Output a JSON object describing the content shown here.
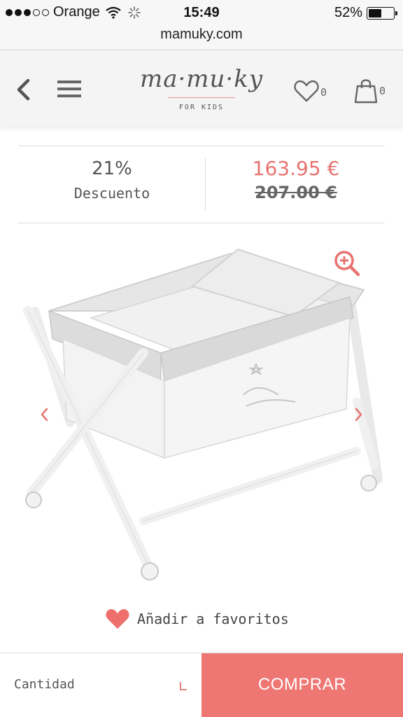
{
  "status_bar": {
    "carrier": "Orange",
    "time": "15:49",
    "battery": "52%",
    "battery_level": 0.52
  },
  "browser": {
    "url": "mamuky.com"
  },
  "header": {
    "logo": "ma·mu·ky",
    "logo_tagline": "FOR KIDS",
    "favorites_count": "0",
    "cart_count": "0"
  },
  "pricing": {
    "discount_percent": "21%",
    "discount_label": "Descuento",
    "current_price": "163.95 €",
    "original_price": "207.00 €"
  },
  "gallery": {
    "icons": [
      "zoom-in-icon",
      "chevron-left-icon",
      "chevron-right-icon"
    ]
  },
  "favorites": {
    "label": "Añadir a favoritos"
  },
  "purchase": {
    "quantity_label": "Cantidad",
    "buy_label": "COMPRAR"
  },
  "colors": {
    "accent": "#ee7774",
    "price": "#e8736f",
    "text": "#555555"
  }
}
